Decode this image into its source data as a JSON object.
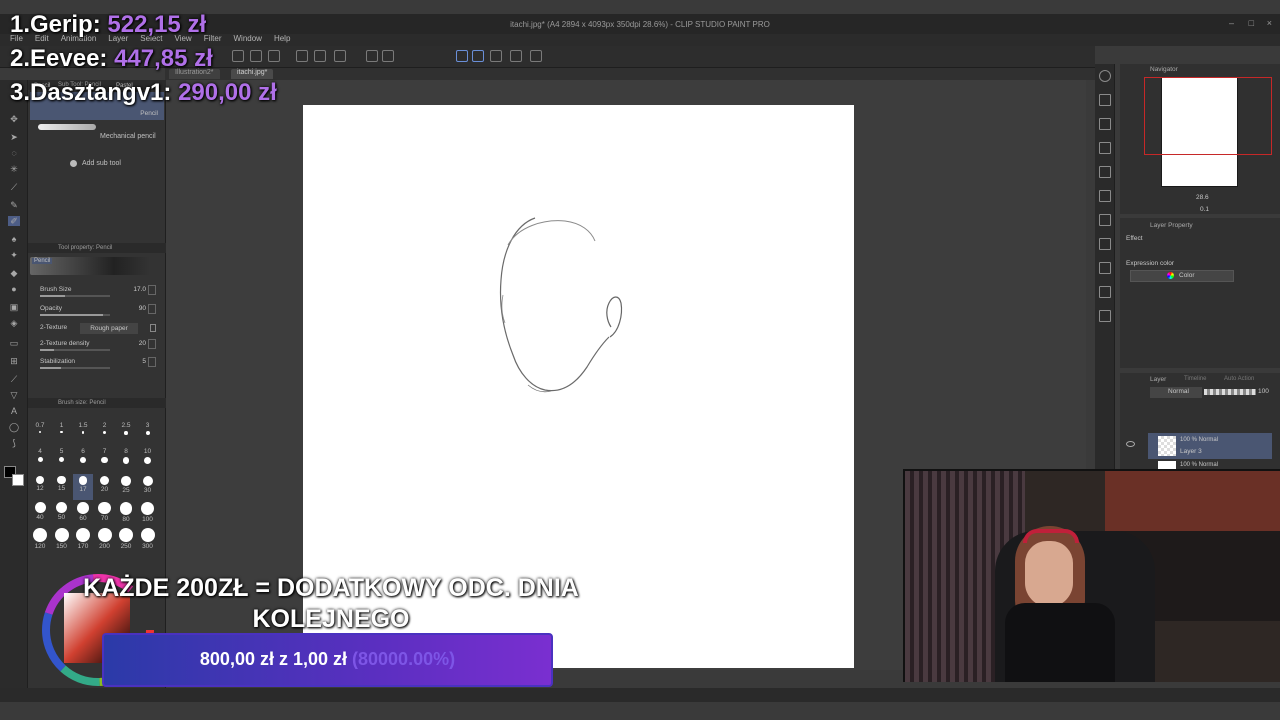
{
  "window": {
    "title": "itachi.jpg* (A4 2894 x 4093px 350dpi 28.6%) - CLIP STUDIO PAINT PRO",
    "minimize": "–",
    "maximize": "□",
    "close": "×"
  },
  "menu": [
    "File",
    "Edit",
    "Animation",
    "Layer",
    "Select",
    "View",
    "Filter",
    "Window",
    "Help"
  ],
  "doc_tabs": [
    "Illustration2*",
    "itachi.jpg*"
  ],
  "sub_tool": {
    "header": "Sub Tool: Pencil",
    "tabs": [
      "Pencil",
      "Pastel"
    ],
    "selected": "Pencil",
    "item": "Mechanical pencil",
    "add": "Add sub tool"
  },
  "tool_property": {
    "header": "Tool property: Pencil",
    "tag": "Pencil",
    "rows": [
      {
        "label": "Brush Size",
        "value": "17.0",
        "fill": 0.35
      },
      {
        "label": "Opacity",
        "value": "90",
        "fill": 0.9
      },
      {
        "label": "2-Texture",
        "value": "Rough paper"
      },
      {
        "label": "2-Texture density",
        "value": "20",
        "fill": 0.2
      },
      {
        "label": "Stabilization",
        "value": "5",
        "fill": 0.3
      }
    ]
  },
  "brush_size": {
    "header": "Brush size: Pencil",
    "sizes": [
      "0.7",
      "1",
      "1.5",
      "2",
      "2.5",
      "3",
      "4",
      "5",
      "6",
      "7",
      "8",
      "10",
      "12",
      "15",
      "17",
      "20",
      "25",
      "30",
      "40",
      "50",
      "60",
      "70",
      "80",
      "100",
      "120",
      "150",
      "170",
      "200",
      "250",
      "300"
    ],
    "selected": "17"
  },
  "navigator": {
    "header": "Navigator",
    "zoom": "28.6",
    "rotation": "0.1"
  },
  "layer_property": {
    "header": "Layer Property",
    "effect": "Effect",
    "expression_color_label": "Expression color",
    "expression_color_value": "Color"
  },
  "layers": {
    "header": "Layer",
    "tabs": [
      "Timeline",
      "Auto Action"
    ],
    "blend": "Normal",
    "opacity": "100",
    "items": [
      {
        "meta": "100 % Normal",
        "name": "Layer 3"
      },
      {
        "meta": "100 % Normal",
        "name": ""
      }
    ]
  },
  "overlay": {
    "leaderboard": [
      {
        "rank": "1.",
        "name": "Gerip:",
        "amount": "522,15 zł"
      },
      {
        "rank": "2.",
        "name": "Eevee:",
        "amount": "447,85 zł"
      },
      {
        "rank": "3.",
        "name": "Dasztangv1:",
        "amount": "290,00 zł"
      }
    ],
    "goal_line1": "KAŻDE 200ZŁ = DODATKOWY ODC. DNIA",
    "goal_line2": "KOLEJNEGO",
    "goal_amount": "800,00 zł z 1,00 zł",
    "goal_percent": "(80000.00%)"
  },
  "colors": {
    "accent": "#b070e8",
    "goal_bar": "#4a32c0",
    "canvas_bg": "#3d3d3d",
    "nav_frame": "#c62828"
  }
}
